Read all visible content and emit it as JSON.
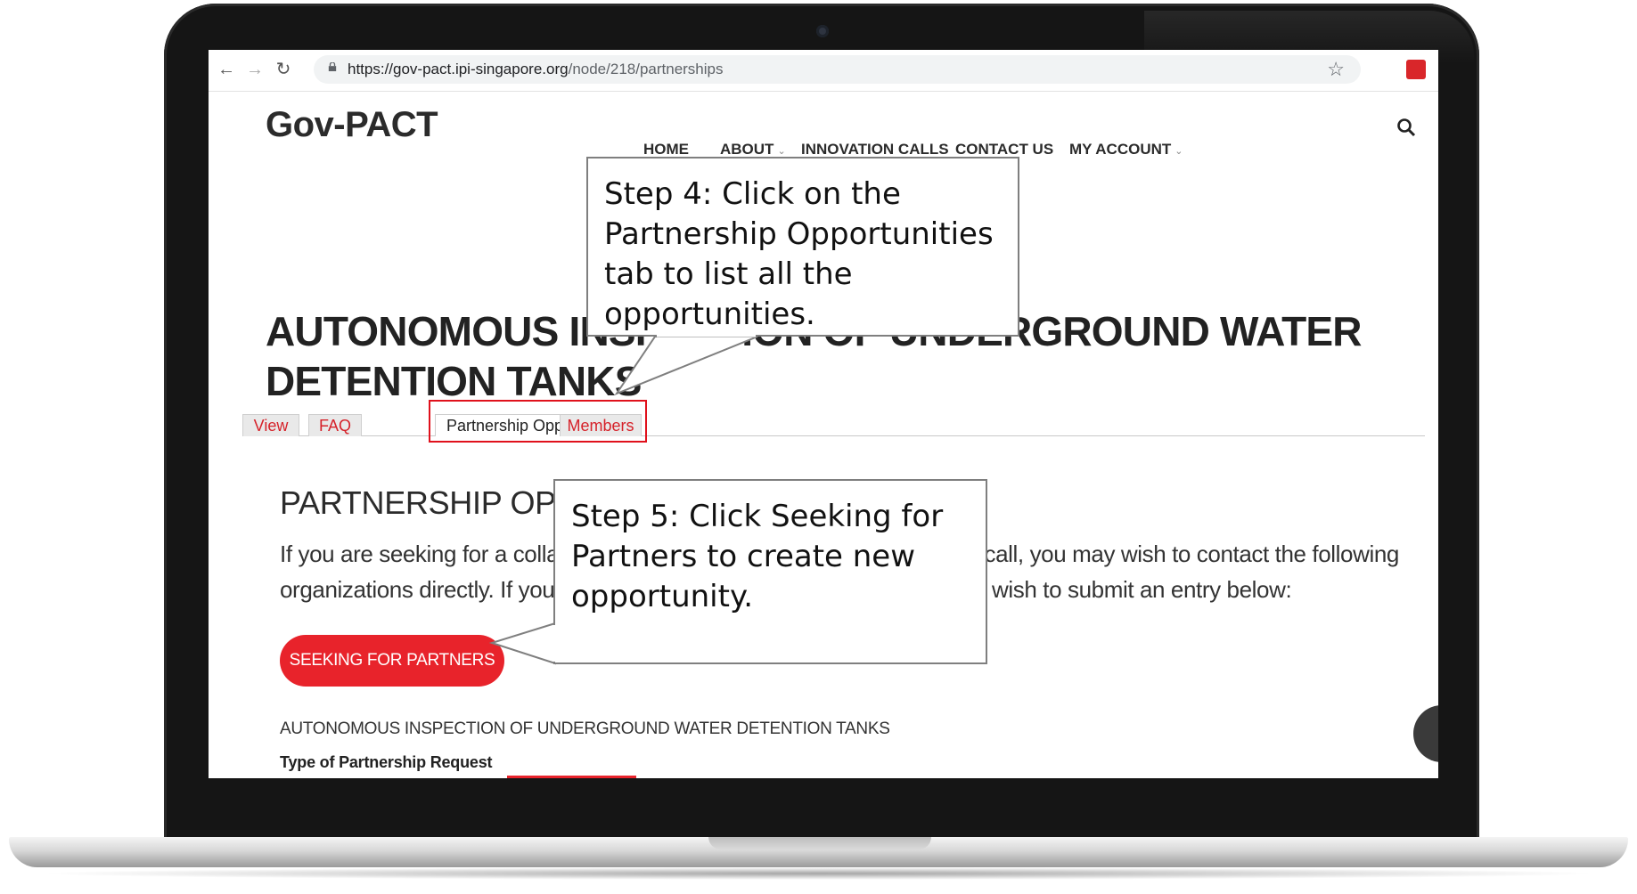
{
  "browser": {
    "url_host": "https://gov-pact.ipi-singapore.org",
    "url_path": "/node/218/partnerships"
  },
  "site": {
    "logo": "Gov-PACT",
    "nav": [
      {
        "label": "HOME"
      },
      {
        "label": "ABOUT"
      },
      {
        "label": "INNOVATION CALLS"
      },
      {
        "label": "CONTACT US"
      },
      {
        "label": "MY ACCOUNT"
      }
    ]
  },
  "page": {
    "title": "AUTONOMOUS INSPECTION OF UNDERGROUND WATER DETENTION TANKS",
    "tabs": [
      {
        "label": "View"
      },
      {
        "label": "FAQ"
      },
      {
        "label": "Partnership Opportunities",
        "active": true
      },
      {
        "label": "Members"
      }
    ],
    "section_heading": "PARTNERSHIP OPPORTUNITIES",
    "intro": "If you are seeking for a collaborator to jointly respond to this innovation call, you may wish to contact the following organizations directly. If you are seeking for a partner yourself, you may wish to submit an entry below:",
    "seek_button": "SEEKING FOR PARTNERS",
    "opportunity_title": "AUTONOMOUS INSPECTION OF UNDERGROUND WATER DETENTION TANKS",
    "opportunity_type_label": "Type of Partnership Request"
  },
  "callouts": {
    "step4": "Step 4: Click on the Partnership Opportunities tab to list all the opportunities.",
    "step5": "Step 5: Click Seeking for Partners to create new opportunity."
  },
  "colors": {
    "accent": "#e8232b",
    "tab_text": "#d6222a",
    "highlight": "#e0111c"
  }
}
